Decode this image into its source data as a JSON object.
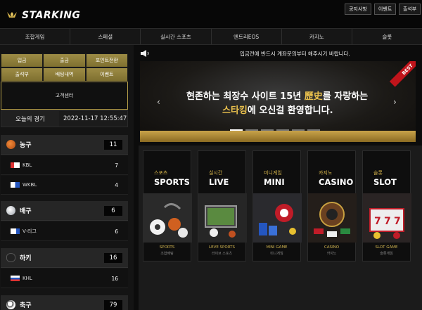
{
  "header": {
    "logo": "STARKING",
    "buttons": [
      "공지사항",
      "이벤트",
      "출석부"
    ]
  },
  "nav": [
    "조합게임",
    "스페셜",
    "실시간 스포츠",
    "엔트리EOS",
    "카지노",
    "슬롯"
  ],
  "sidebar": {
    "menu": [
      [
        "입금",
        "출금",
        "포인트전환"
      ],
      [
        "출석부",
        "배팅내역",
        "이벤트"
      ]
    ],
    "support": "고객센터",
    "today_label": "오늘의 경기",
    "today_datetime": "2022-11-17 12:55:47",
    "sports": [
      {
        "name": "농구",
        "count": "11",
        "leagues": [
          {
            "name": "KBL",
            "count": "7"
          },
          {
            "name": "WKBL",
            "count": "4"
          }
        ]
      },
      {
        "name": "배구",
        "count": "6",
        "leagues": [
          {
            "name": "V-리그",
            "count": "6"
          }
        ]
      },
      {
        "name": "하키",
        "count": "16",
        "leagues": [
          {
            "name": "KHL",
            "count": "16"
          }
        ]
      },
      {
        "name": "축구",
        "count": "79",
        "leagues": []
      }
    ]
  },
  "notice": "입금전에 반드시 계좌문의부터 해주시기 바랍니다.",
  "banner": {
    "ribbon": "BEST",
    "line1_pre": "현존하는 최장수 사이트 15년 ",
    "line1_gold": "歷史",
    "line1_post": "를 자랑하는",
    "line2_gold": "스타킹",
    "line2_post": "에 오신걸 환영합니다."
  },
  "games": [
    {
      "ko": "스포츠",
      "en": "SPORTS",
      "cap": "SPORTS",
      "sub": "조합배팅"
    },
    {
      "ko": "실시간",
      "en": "LIVE",
      "cap": "LEVE SPORTS",
      "sub": "라이브 스포츠"
    },
    {
      "ko": "미니게임",
      "en": "MINI",
      "cap": "MINI GAME",
      "sub": "미니게임"
    },
    {
      "ko": "카지노",
      "en": "CASINO",
      "cap": "CASINO",
      "sub": "카지노"
    },
    {
      "ko": "슬롯",
      "en": "SLOT",
      "cap": "SLOT GAME",
      "sub": "슬롯게임"
    }
  ],
  "colors": {
    "gold": "#d4b34a",
    "button_gold": "#8f7f3a",
    "ribbon_red": "#c0141b"
  }
}
